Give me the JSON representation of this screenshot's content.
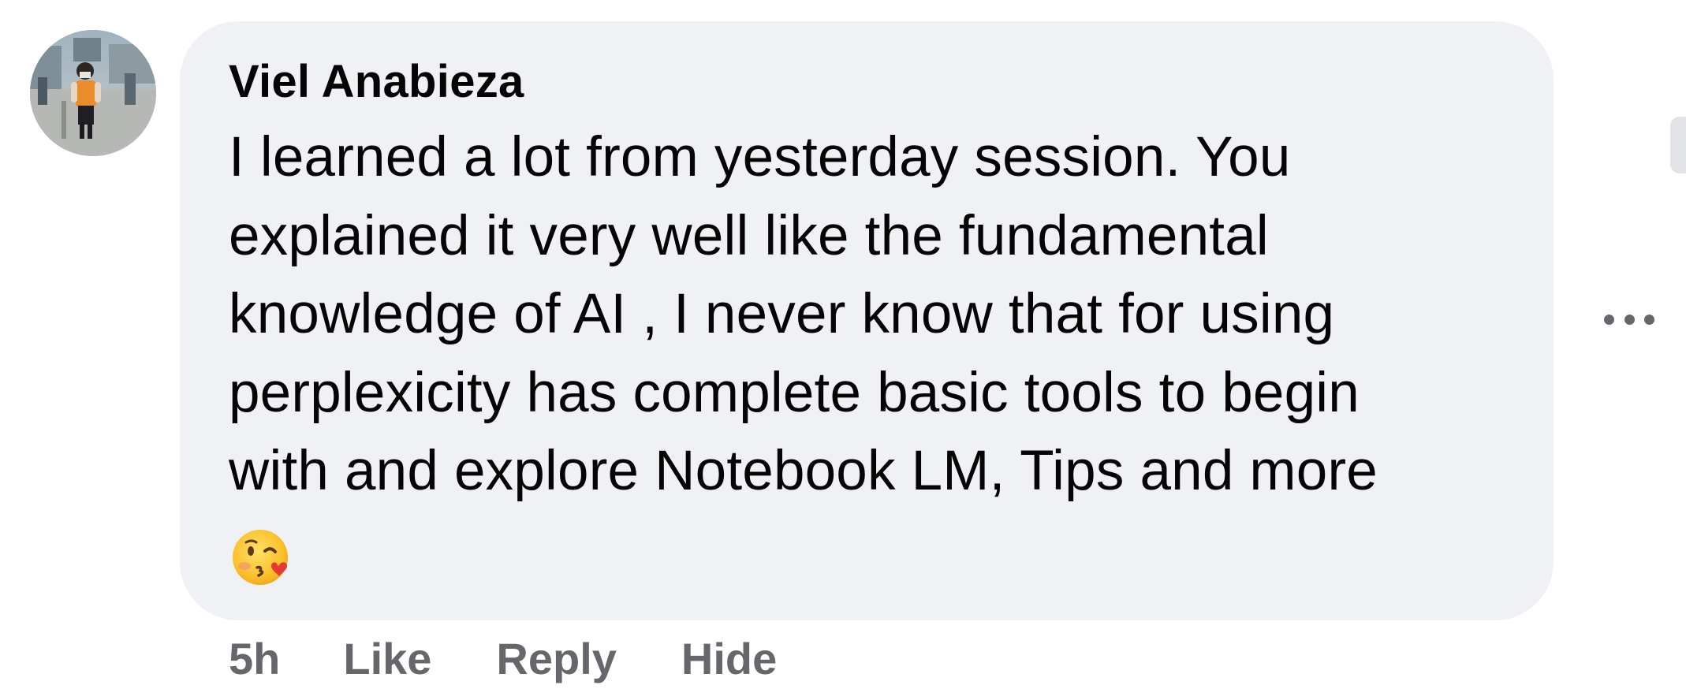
{
  "comment": {
    "author_name": "Viel Anabieza",
    "text_lines": [
      "I learned a lot from yesterday session. You",
      "explained it very well like the fundamental",
      "knowledge of AI , I never know that for using",
      "perplexicity has complete basic tools to begin",
      "with and explore Notebook LM, Tips and more"
    ],
    "emoji": "kissing-face-with-heart-emoji"
  },
  "actions": {
    "time": "5h",
    "like_label": "Like",
    "reply_label": "Reply",
    "hide_label": "Hide"
  },
  "icons": {
    "avatar": "avatar-photo",
    "more": "more-options-icon"
  },
  "colors": {
    "bubble_background": "#f0f1f5",
    "text_primary": "#050505",
    "text_secondary": "#65676b"
  }
}
